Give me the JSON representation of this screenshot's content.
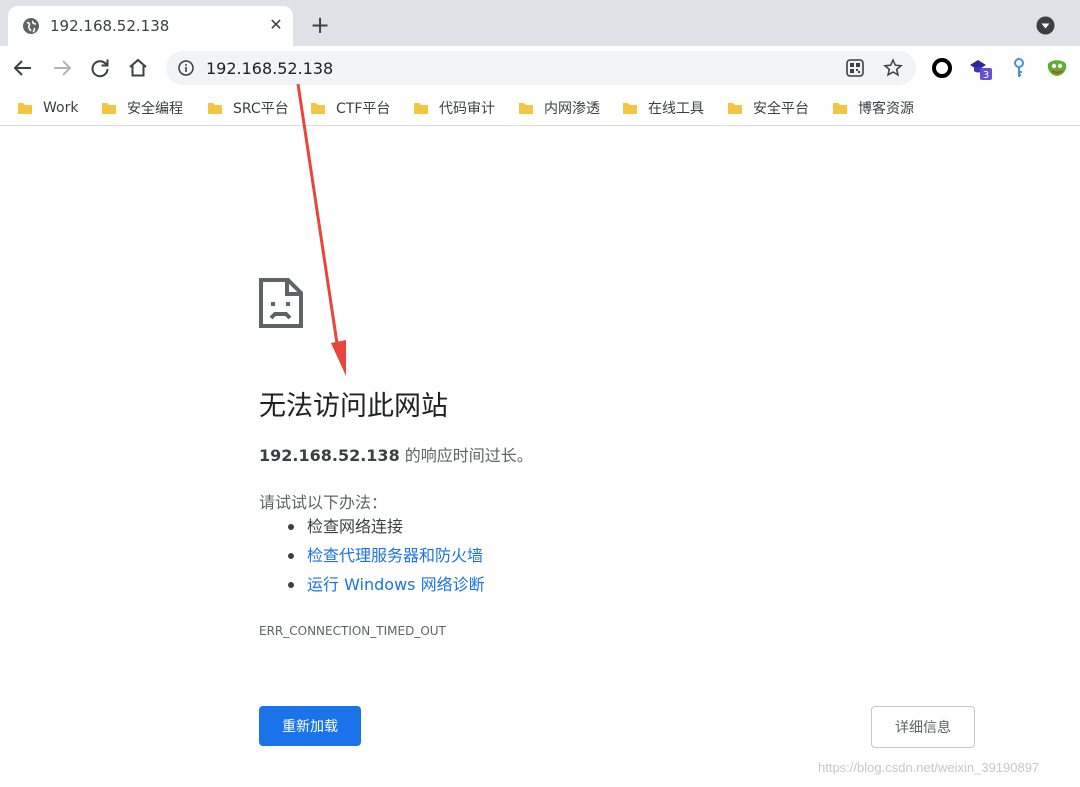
{
  "tab": {
    "title": "192.168.52.138",
    "close_glyph": "✕",
    "favicon": "globe-icon"
  },
  "newtab_glyph": "+",
  "toolbar": {
    "url": "192.168.52.138"
  },
  "extensions": {
    "badge_count": "3"
  },
  "bookmarks": [
    {
      "label": "Work"
    },
    {
      "label": "安全编程"
    },
    {
      "label": "SRC平台"
    },
    {
      "label": "CTF平台"
    },
    {
      "label": "代码审计"
    },
    {
      "label": "内网渗透"
    },
    {
      "label": "在线工具"
    },
    {
      "label": "安全平台"
    },
    {
      "label": "博客资源"
    }
  ],
  "error": {
    "title": "无法访问此网站",
    "host": "192.168.52.138",
    "desc_suffix": " 的响应时间过长。",
    "suggest_heading": "请试试以下办法：",
    "suggestions": [
      {
        "text": "检查网络连接",
        "is_link": false
      },
      {
        "text": "检查代理服务器和防火墙",
        "is_link": true
      },
      {
        "text": "运行 Windows 网络诊断",
        "is_link": true
      }
    ],
    "code": "ERR_CONNECTION_TIMED_OUT",
    "reload_label": "重新加载",
    "details_label": "详细信息"
  },
  "watermark": "https://blog.csdn.net/weixin_39190897",
  "colors": {
    "accent": "#1a73e8",
    "annotation_arrow": "#e8453c",
    "folder": "#f4c542"
  }
}
